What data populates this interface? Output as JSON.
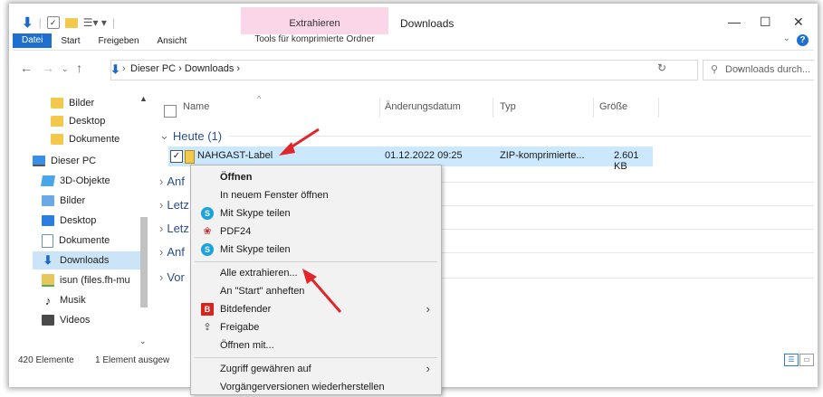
{
  "ribbon": {
    "tabs": [
      "Datei",
      "Start",
      "Freigeben",
      "Ansicht",
      "Tools für komprimierte Ordner"
    ],
    "context_group": "Extrahieren",
    "window_title": "Downloads",
    "help": "?"
  },
  "address": {
    "crumbs": "Dieser PC  ›  Downloads  ›",
    "search_placeholder": "Downloads durch..."
  },
  "sidebar": {
    "items": [
      "Bilder",
      "Desktop",
      "Dokumente",
      "Dieser PC",
      "3D-Objekte",
      "Bilder",
      "Desktop",
      "Dokumente",
      "Downloads",
      "isun (files.fh-mu",
      "Musik",
      "Videos"
    ]
  },
  "columns": {
    "name": "Name",
    "date": "Änderungsdatum",
    "type": "Typ",
    "size": "Größe"
  },
  "groups": [
    "Heute (1)",
    "Anf",
    "Letz",
    "Letz",
    "Anf",
    "Vor"
  ],
  "file": {
    "name": "NAHGAST-Label",
    "date": "01.12.2022 09:25",
    "type": "ZIP-komprimierte...",
    "size": "2.601 KB"
  },
  "status": {
    "count": "420 Elemente",
    "selected": "1 Element ausgew"
  },
  "context_menu": {
    "items": [
      "Öffnen",
      "In neuem Fenster öffnen",
      "Mit Skype teilen",
      "PDF24",
      "Mit Skype teilen",
      "Alle extrahieren...",
      "An \"Start\" anheften",
      "Bitdefender",
      "Freigabe",
      "Öffnen mit...",
      "Zugriff gewähren auf",
      "Vorgängerversionen wiederherstellen"
    ]
  },
  "colors": {
    "accent": "#1e6fd0",
    "selection": "#cce8ff",
    "context_tab": "#fbd6e8",
    "annotation_arrow": "#e0262a"
  }
}
